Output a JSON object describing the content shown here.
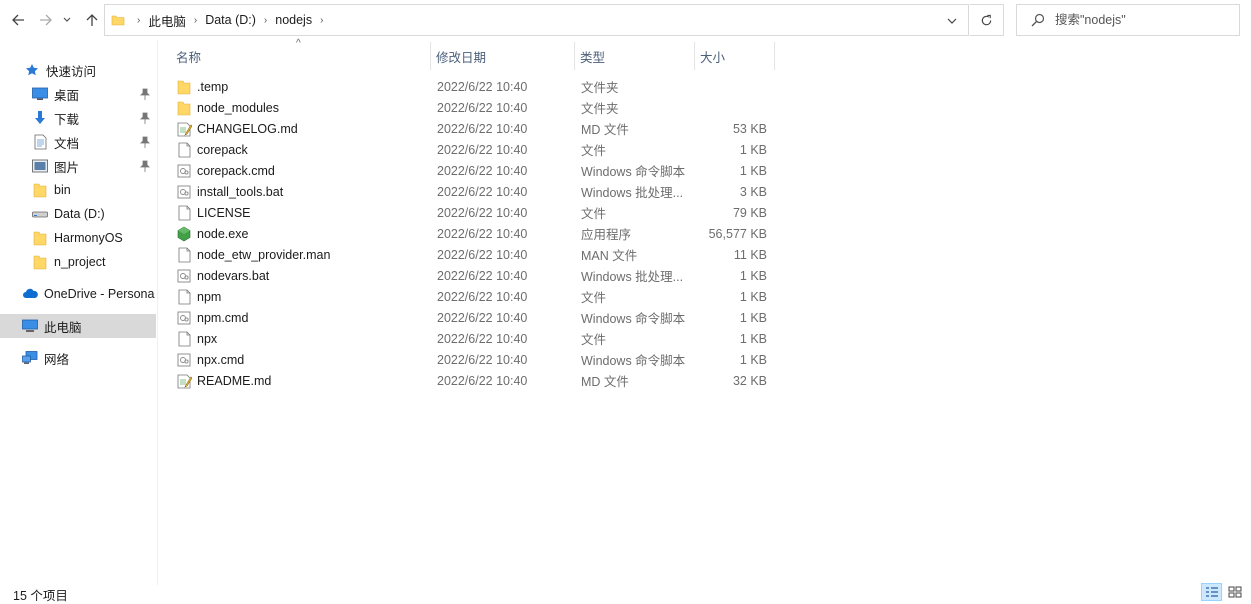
{
  "navigation": {
    "back_icon": "arrow-left-icon",
    "forward_icon": "arrow-right-icon",
    "recent_icon": "chevron-down-icon",
    "up_icon": "arrow-up-icon",
    "breadcrumb": [
      "此电脑",
      "Data (D:)",
      "nodejs"
    ],
    "refresh_icon": "refresh-icon"
  },
  "search": {
    "placeholder": "搜索\"nodejs\""
  },
  "sidebar": {
    "items": [
      {
        "label": "快速访问",
        "icon": "star-icon"
      },
      {
        "label": "桌面",
        "icon": "desktop-icon",
        "pinned": true
      },
      {
        "label": "下载",
        "icon": "download-icon",
        "pinned": true
      },
      {
        "label": "文档",
        "icon": "document-icon",
        "pinned": true
      },
      {
        "label": "图片",
        "icon": "picture-icon",
        "pinned": true
      },
      {
        "label": "bin",
        "icon": "folder-icon"
      },
      {
        "label": "Data (D:)",
        "icon": "drive-icon"
      },
      {
        "label": "HarmonyOS",
        "icon": "folder-icon"
      },
      {
        "label": "n_project",
        "icon": "folder-icon"
      },
      {
        "label": "OneDrive - Persona",
        "icon": "cloud-icon"
      },
      {
        "label": "此电脑",
        "icon": "computer-icon",
        "selected": true
      },
      {
        "label": "网络",
        "icon": "network-icon"
      }
    ]
  },
  "columns": {
    "name": "名称",
    "date": "修改日期",
    "type": "类型",
    "size": "大小"
  },
  "files": [
    {
      "name": ".temp",
      "date": "2022/6/22 10:40",
      "type": "文件夹",
      "size": "",
      "icon": "folder"
    },
    {
      "name": "node_modules",
      "date": "2022/6/22 10:40",
      "type": "文件夹",
      "size": "",
      "icon": "folder"
    },
    {
      "name": "CHANGELOG.md",
      "date": "2022/6/22 10:40",
      "type": "MD 文件",
      "size": "53 KB",
      "icon": "markdown"
    },
    {
      "name": "corepack",
      "date": "2022/6/22 10:40",
      "type": "文件",
      "size": "1 KB",
      "icon": "file"
    },
    {
      "name": "corepack.cmd",
      "date": "2022/6/22 10:40",
      "type": "Windows 命令脚本",
      "size": "1 KB",
      "icon": "script"
    },
    {
      "name": "install_tools.bat",
      "date": "2022/6/22 10:40",
      "type": "Windows 批处理...",
      "size": "3 KB",
      "icon": "script"
    },
    {
      "name": "LICENSE",
      "date": "2022/6/22 10:40",
      "type": "文件",
      "size": "79 KB",
      "icon": "file"
    },
    {
      "name": "node.exe",
      "date": "2022/6/22 10:40",
      "type": "应用程序",
      "size": "56,577 KB",
      "icon": "node"
    },
    {
      "name": "node_etw_provider.man",
      "date": "2022/6/22 10:40",
      "type": "MAN 文件",
      "size": "11 KB",
      "icon": "file"
    },
    {
      "name": "nodevars.bat",
      "date": "2022/6/22 10:40",
      "type": "Windows 批处理...",
      "size": "1 KB",
      "icon": "script"
    },
    {
      "name": "npm",
      "date": "2022/6/22 10:40",
      "type": "文件",
      "size": "1 KB",
      "icon": "file"
    },
    {
      "name": "npm.cmd",
      "date": "2022/6/22 10:40",
      "type": "Windows 命令脚本",
      "size": "1 KB",
      "icon": "script"
    },
    {
      "name": "npx",
      "date": "2022/6/22 10:40",
      "type": "文件",
      "size": "1 KB",
      "icon": "file"
    },
    {
      "name": "npx.cmd",
      "date": "2022/6/22 10:40",
      "type": "Windows 命令脚本",
      "size": "1 KB",
      "icon": "script"
    },
    {
      "name": "README.md",
      "date": "2022/6/22 10:40",
      "type": "MD 文件",
      "size": "32 KB",
      "icon": "markdown"
    }
  ],
  "status": {
    "item_count": "15 个项目"
  },
  "colors": {
    "folder": "#ffd766",
    "selection": "#d9d9d9",
    "header_text": "#4c607a",
    "accent": "#0078d7"
  }
}
